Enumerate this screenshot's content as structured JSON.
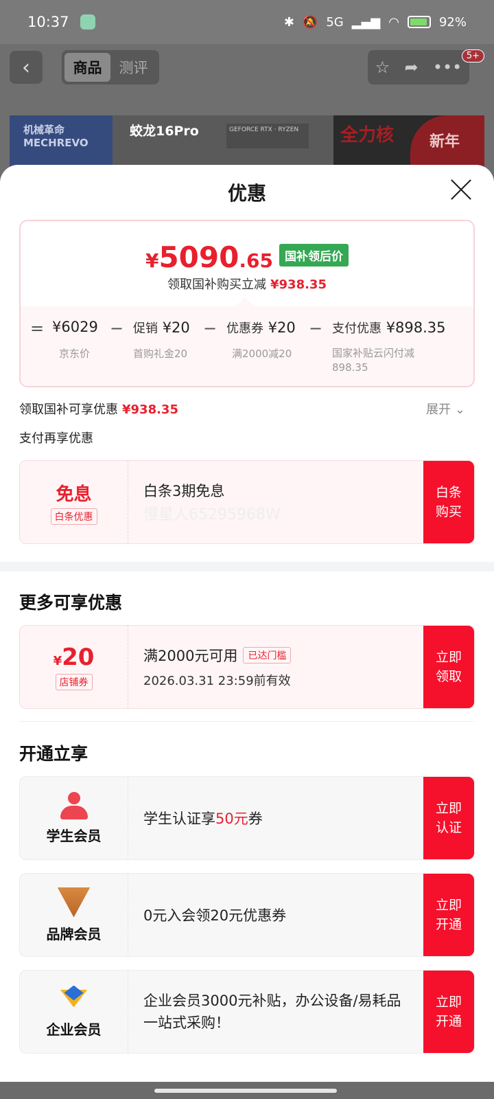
{
  "status_bar": {
    "time": "10:37",
    "signal": "5G",
    "battery": "92%"
  },
  "background_page": {
    "tabs": [
      "商品",
      "测评"
    ],
    "active_tab": "商品",
    "badge": "5+",
    "banner_brand": "机械革命\nMECHREVO",
    "banner_model": "蛟龙16Pro",
    "banner_chip": "GEFORCE RTX · RYZEN",
    "banner_slogan": "全力核",
    "banner_new": "新年"
  },
  "sheet": {
    "title": "优惠",
    "price": {
      "yen": "¥",
      "integer": "5090",
      "decimal": ".65",
      "tag": "国补领后价"
    },
    "price_sub": {
      "text": "领取国补购买立减",
      "amount": "¥938.35"
    },
    "calc": {
      "eq": "=",
      "items": [
        {
          "label": "",
          "value": "¥6029",
          "sub": "京东价"
        },
        {
          "label": "促销",
          "value": "¥20",
          "sub": "首购礼金20"
        },
        {
          "label": "优惠券",
          "value": "¥20",
          "sub": "满2000减20"
        },
        {
          "label": "支付优惠",
          "value": "¥898.35",
          "sub": "国家补贴云闪付减898.35"
        }
      ],
      "minus": "−"
    },
    "gov_row": {
      "text": "领取国补可享优惠",
      "amount": "¥938.35",
      "expand": "展开"
    },
    "pay_row": "支付再享优惠",
    "baitiao": {
      "title": "免息",
      "tag": "白条优惠",
      "desc": "白条3期免息",
      "watermark": "慢星人65295968W",
      "button": "白条购买"
    },
    "more_title": "更多可享优惠",
    "coupon": {
      "yen": "¥",
      "amount": "20",
      "tag": "店铺券",
      "desc": "满2000元可用",
      "reach": "已达门槛",
      "expire": "2026.03.31 23:59前有效",
      "button": "立即领取"
    },
    "open_title": "开通立享",
    "members": [
      {
        "name": "学生会员",
        "desc_pre": "学生认证享",
        "desc_red": "50元",
        "desc_post": "券",
        "button": "立即认证",
        "icon": "person-icon"
      },
      {
        "name": "品牌会员",
        "desc_pre": "0元入会领20元优惠券",
        "desc_red": "",
        "desc_post": "",
        "button": "立即开通",
        "icon": "brand-v-icon"
      },
      {
        "name": "企业会员",
        "desc_pre": "企业会员3000元补贴，办公设备/易耗品一站式采购！",
        "desc_red": "",
        "desc_post": "",
        "button": "立即开通",
        "icon": "enterprise-icon"
      }
    ]
  }
}
